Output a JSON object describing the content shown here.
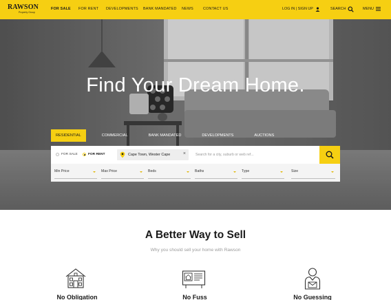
{
  "header": {
    "logo": {
      "brand": "RAWSON",
      "sub": "Property Group"
    },
    "nav": [
      "FOR SALE",
      "FOR RENT",
      "DEVELOPMENTS",
      "BANK MANDATED",
      "NEWS",
      "CONTACT US"
    ],
    "active_nav": "FOR SALE",
    "login_label": "LOG IN | SIGN UP",
    "search_label": "SEARCH",
    "menu_label": "MENU"
  },
  "hero": {
    "title": "Find Your Dream Home.",
    "tabs": [
      "RESIDENTIAL",
      "COMMERCIAL",
      "BANK MANDATED",
      "DEVELOPMENTS",
      "AUCTIONS"
    ],
    "active_tab": "RESIDENTIAL"
  },
  "search": {
    "listing_types": [
      "FOR SALE",
      "FOR RENT"
    ],
    "selected_listing_type": "FOR RENT",
    "location_chip": "Cape Town, Wester Cape",
    "placeholder": "Search for a city, suburb or web ref...",
    "filters": [
      "Min Price",
      "Max Price",
      "Beds",
      "Baths",
      "Type",
      "Size"
    ]
  },
  "benefits": {
    "title": "A Better Way to Sell",
    "subtitle": "Why you should sell your home with Rawson",
    "items": [
      {
        "title": "No Obligation",
        "icon": "house-icon"
      },
      {
        "title": "No Fuss",
        "icon": "listing-board-icon"
      },
      {
        "title": "No Guessing",
        "icon": "agent-icon"
      }
    ]
  },
  "colors": {
    "accent": "#f6cf12",
    "text": "#1a1a1a",
    "muted": "#9a9a9a"
  }
}
